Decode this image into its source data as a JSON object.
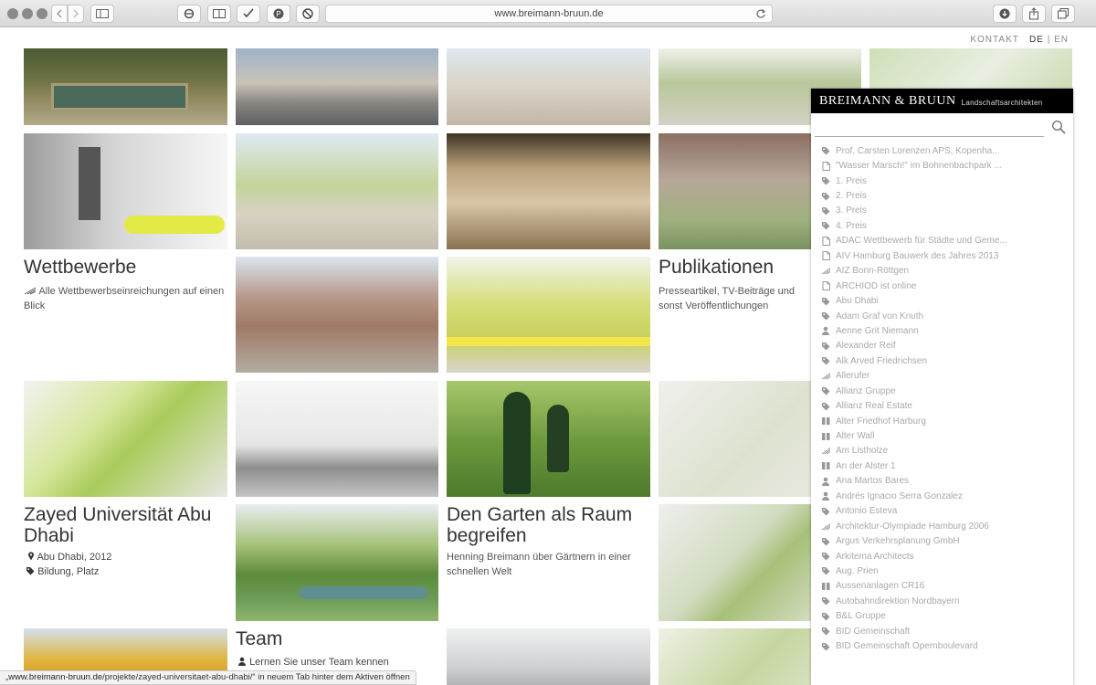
{
  "browser": {
    "url": "www.breimann-bruun.de",
    "status_url": "www.breimann-bruun.de",
    "status_path": "/projekte/zayed-universitaet-abu-dhabi/",
    "status_text": "in neuem Tab hinter dem Aktiven öffnen"
  },
  "nav": {
    "kontakt": "KONTAKT",
    "de": "DE",
    "sep": "|",
    "en": "EN"
  },
  "tiles": {
    "wettbewerbe": {
      "title": "Wettbewerbe",
      "text": "Alle Wettbewerbseinreichungen auf einen Blick"
    },
    "publikationen": {
      "title": "Publikationen",
      "text": "Presseartikel, TV-Beiträge und sonst Veröffentlichungen"
    },
    "zayed": {
      "title": "Zayed Universität Abu Dhabi",
      "location": "Abu Dhabi, 2012",
      "tags": "Bildung, Platz"
    },
    "garten": {
      "title": "Den Garten als Raum begreifen",
      "text": "Henning Breimann über Gärtnern in einer schnellen Welt"
    },
    "team": {
      "title": "Team",
      "text": "Lernen Sie unser Team kennen"
    }
  },
  "panel": {
    "brand": "BREIMANN & BRUUN",
    "tagline": "Landschaftsarchitekten",
    "search_value": "",
    "items": [
      {
        "icon": "tag",
        "label": "Prof. Carsten Lorenzen APS, Kopenha..."
      },
      {
        "icon": "doc",
        "label": "\"Wasser Marsch!\" im Bohnenbachpark ..."
      },
      {
        "icon": "tag",
        "label": "1. Preis"
      },
      {
        "icon": "tag",
        "label": "2. Preis"
      },
      {
        "icon": "tag",
        "label": "3. Preis"
      },
      {
        "icon": "tag",
        "label": "4. Preis"
      },
      {
        "icon": "doc",
        "label": "ADAC Wettbewerb für Städte und Geme..."
      },
      {
        "icon": "doc",
        "label": "AIV Hamburg Bauwerk des Jahres 2013"
      },
      {
        "icon": "compass",
        "label": "AIZ Bonn-Röttgen"
      },
      {
        "icon": "doc",
        "label": "ARCHIOD ist online"
      },
      {
        "icon": "tag",
        "label": "Abu Dhabi"
      },
      {
        "icon": "tag",
        "label": "Adam Graf von Knuth"
      },
      {
        "icon": "person",
        "label": "Aenne Grit Niemann"
      },
      {
        "icon": "tag",
        "label": "Alexander Reif"
      },
      {
        "icon": "tag",
        "label": "Alk Arved Friedrichsen"
      },
      {
        "icon": "compass",
        "label": "Allerufer"
      },
      {
        "icon": "tag",
        "label": "Allianz Gruppe"
      },
      {
        "icon": "tag",
        "label": "Allianz Real Estate"
      },
      {
        "icon": "people",
        "label": "Alter Friedhof Harburg"
      },
      {
        "icon": "people",
        "label": "Alter Wall"
      },
      {
        "icon": "compass",
        "label": "Am Listholze"
      },
      {
        "icon": "people",
        "label": "An der Alster 1"
      },
      {
        "icon": "person",
        "label": "Ana Martos Bares"
      },
      {
        "icon": "person",
        "label": "Andrés Ignacio Serra Gonzalez"
      },
      {
        "icon": "tag",
        "label": "Antonio Esteva"
      },
      {
        "icon": "compass",
        "label": "Architektur-Olympiade Hamburg 2006"
      },
      {
        "icon": "tag",
        "label": "Argus Verkehrsplanung GmbH"
      },
      {
        "icon": "tag",
        "label": "Arkitema Architects"
      },
      {
        "icon": "tag",
        "label": "Aug. Prien"
      },
      {
        "icon": "people",
        "label": "Aussenanlagen CR16"
      },
      {
        "icon": "tag",
        "label": "Autobahndirektion Nordbayern"
      },
      {
        "icon": "tag",
        "label": "B&L Gruppe"
      },
      {
        "icon": "tag",
        "label": "BID Gemeinschaft"
      },
      {
        "icon": "tag",
        "label": "BID Gemeinschaft Opernboulevard"
      }
    ]
  }
}
